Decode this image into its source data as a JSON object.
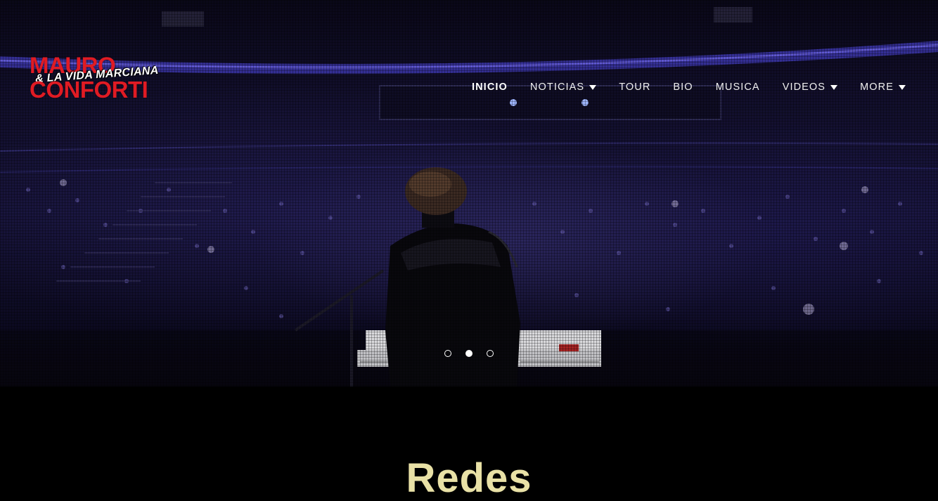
{
  "brand": {
    "line1": "MAURO",
    "line2": "& LA VIDA MARCIANA",
    "line3": "CONFORTI",
    "color": "#e01b24"
  },
  "nav": {
    "items": [
      {
        "label": "INICIO",
        "active": true,
        "dropdown": false
      },
      {
        "label": "NOTICIAS",
        "active": false,
        "dropdown": true
      },
      {
        "label": "TOUR",
        "active": false,
        "dropdown": false
      },
      {
        "label": "BIO",
        "active": false,
        "dropdown": false
      },
      {
        "label": "MUSICA",
        "active": false,
        "dropdown": false
      },
      {
        "label": "VIDEOS",
        "active": false,
        "dropdown": true
      },
      {
        "label": "MORE",
        "active": false,
        "dropdown": true
      }
    ]
  },
  "slider": {
    "slide_count": 3,
    "active_index": 1
  },
  "section": {
    "title": "Redes",
    "title_color": "#e9e1a6"
  }
}
